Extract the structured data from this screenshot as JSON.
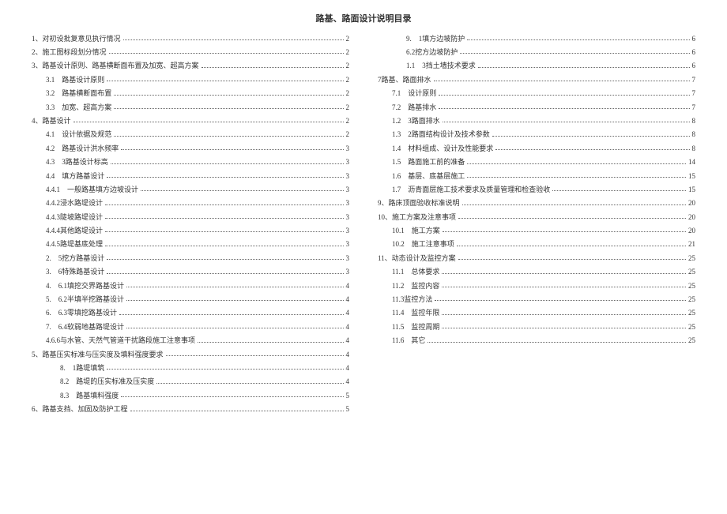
{
  "title": "路基、路面设计说明目录",
  "left": [
    {
      "indent": 0,
      "label": "1、对初设批复意见执行情况",
      "page": "2"
    },
    {
      "indent": 0,
      "label": "2、施工图标段划分情况",
      "page": "2"
    },
    {
      "indent": 0,
      "label": "3、路基设计原则、路基横断面布置及加宽、超高方案",
      "page": "2"
    },
    {
      "indent": 1,
      "label": "3.1　路基设计原则",
      "page": "2"
    },
    {
      "indent": 1,
      "label": "3.2　路基横断面布置",
      "page": "2"
    },
    {
      "indent": 1,
      "label": "3.3　加宽、超高方案",
      "page": "2"
    },
    {
      "indent": 0,
      "label": "4、路基设计",
      "page": "2"
    },
    {
      "indent": 1,
      "label": "4.1　设计依据及规范",
      "page": "2"
    },
    {
      "indent": 1,
      "label": "4.2　路基设计洪水频率",
      "page": "3"
    },
    {
      "indent": 1,
      "label": "4.3　3路基设计标高",
      "page": "3"
    },
    {
      "indent": 1,
      "label": "4.4　填方路基设计",
      "page": "3"
    },
    {
      "indent": 1,
      "label": "4.4.1　一般路基填方边坡设计",
      "page": "3"
    },
    {
      "indent": 1,
      "label": "4.4.2浸水路堤设计",
      "page": "3"
    },
    {
      "indent": 1,
      "label": "4.4.3陡坡路堤设计",
      "page": "3"
    },
    {
      "indent": 1,
      "label": "4.4.4其他路堤设计",
      "page": "3"
    },
    {
      "indent": 1,
      "label": "4.4.5路堤基底处理",
      "page": "3"
    },
    {
      "indent": 1,
      "label": "2.　5挖方路基设计",
      "page": "3"
    },
    {
      "indent": 1,
      "label": "3.　6特殊路基设计",
      "page": "3"
    },
    {
      "indent": 1,
      "label": "4.　6.1填挖交界路基设计",
      "page": "4"
    },
    {
      "indent": 1,
      "label": "5.　6.2半填半挖路基设计",
      "page": "4"
    },
    {
      "indent": 1,
      "label": "6.　6.3零填挖路基设计",
      "page": "4"
    },
    {
      "indent": 1,
      "label": "7.　6.4软弱地基路堤设计",
      "page": "4"
    },
    {
      "indent": 1,
      "label": "4.6.6与水管、天然气管道干扰路段施工注意事项",
      "page": "4"
    },
    {
      "indent": 0,
      "label": "5、路基压实标准与压实度及填料强度要求",
      "page": "4"
    },
    {
      "indent": 2,
      "label": "8.　1路堤填筑",
      "page": "4"
    },
    {
      "indent": 2,
      "label": "8.2　路堤的压实标准及压实度",
      "page": "4"
    },
    {
      "indent": 2,
      "label": "8.3　路基填料强度",
      "page": "5"
    },
    {
      "indent": 0,
      "label": "6、路基支挡、加固及防护工程",
      "page": "5"
    }
  ],
  "right": [
    {
      "indent": 2,
      "label": "9.　1填方边坡防护",
      "page": "6"
    },
    {
      "indent": 2,
      "label": "6.2挖方边坡防护",
      "page": "6"
    },
    {
      "indent": 2,
      "label": "1.1　3挡土墙技术要求",
      "page": "6"
    },
    {
      "indent": 0,
      "label": "7路基、路面排水",
      "page": "7"
    },
    {
      "indent": 1,
      "label": "7.1　设计原则",
      "page": "7"
    },
    {
      "indent": 1,
      "label": "7.2　路基排水",
      "page": "7"
    },
    {
      "indent": 1,
      "label": "1.2　3路面排水",
      "page": "8"
    },
    {
      "indent": 1,
      "label": "1.3　2路面结构设计及技术参数",
      "page": "8"
    },
    {
      "indent": 1,
      "label": "1.4　材料组成、设计及性能要求",
      "page": "8"
    },
    {
      "indent": 1,
      "label": "1.5　路面施工前的准备",
      "page": "14"
    },
    {
      "indent": 1,
      "label": "1.6　基层、底基层施工",
      "page": "15"
    },
    {
      "indent": 1,
      "label": "1.7　沥青面层施工技术要求及质量管理和检查验收",
      "page": "15"
    },
    {
      "indent": 0,
      "label": "9、路床顶面验收标准说明",
      "page": "20"
    },
    {
      "indent": 0,
      "label": "10、施工方案及注意事项",
      "page": "20"
    },
    {
      "indent": 1,
      "label": "10.1　施工方案",
      "page": "20"
    },
    {
      "indent": 1,
      "label": "10.2　施工注意事项",
      "page": "21"
    },
    {
      "indent": 0,
      "label": "11、动态设计及监控方案",
      "page": "25"
    },
    {
      "indent": 1,
      "label": "11.1　总体要求",
      "page": "25"
    },
    {
      "indent": 1,
      "label": "11.2　监控内容",
      "page": "25"
    },
    {
      "indent": 1,
      "label": "11.3监控方法",
      "page": "25"
    },
    {
      "indent": 1,
      "label": "11.4　监控年限",
      "page": "25"
    },
    {
      "indent": 1,
      "label": "11.5　监控周期",
      "page": "25"
    },
    {
      "indent": 1,
      "label": "11.6　其它",
      "page": "25"
    }
  ]
}
